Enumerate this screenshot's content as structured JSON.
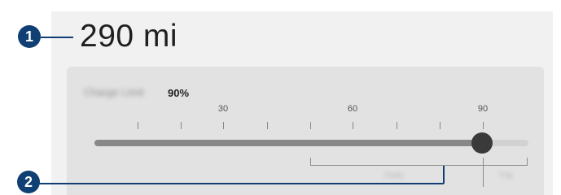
{
  "range": {
    "value": "290 mi"
  },
  "charge_limit": {
    "label": "Charge Limit",
    "value": "90%",
    "percent": 90,
    "scale_labels": [
      "30",
      "60",
      "90"
    ],
    "lower_label": "Daily",
    "upper_label": "Trip"
  },
  "callouts": [
    "1",
    "2"
  ],
  "colors": {
    "callout": "#0f3f73",
    "slider_fill": "#888888",
    "thumb": "#3a3a3a"
  }
}
